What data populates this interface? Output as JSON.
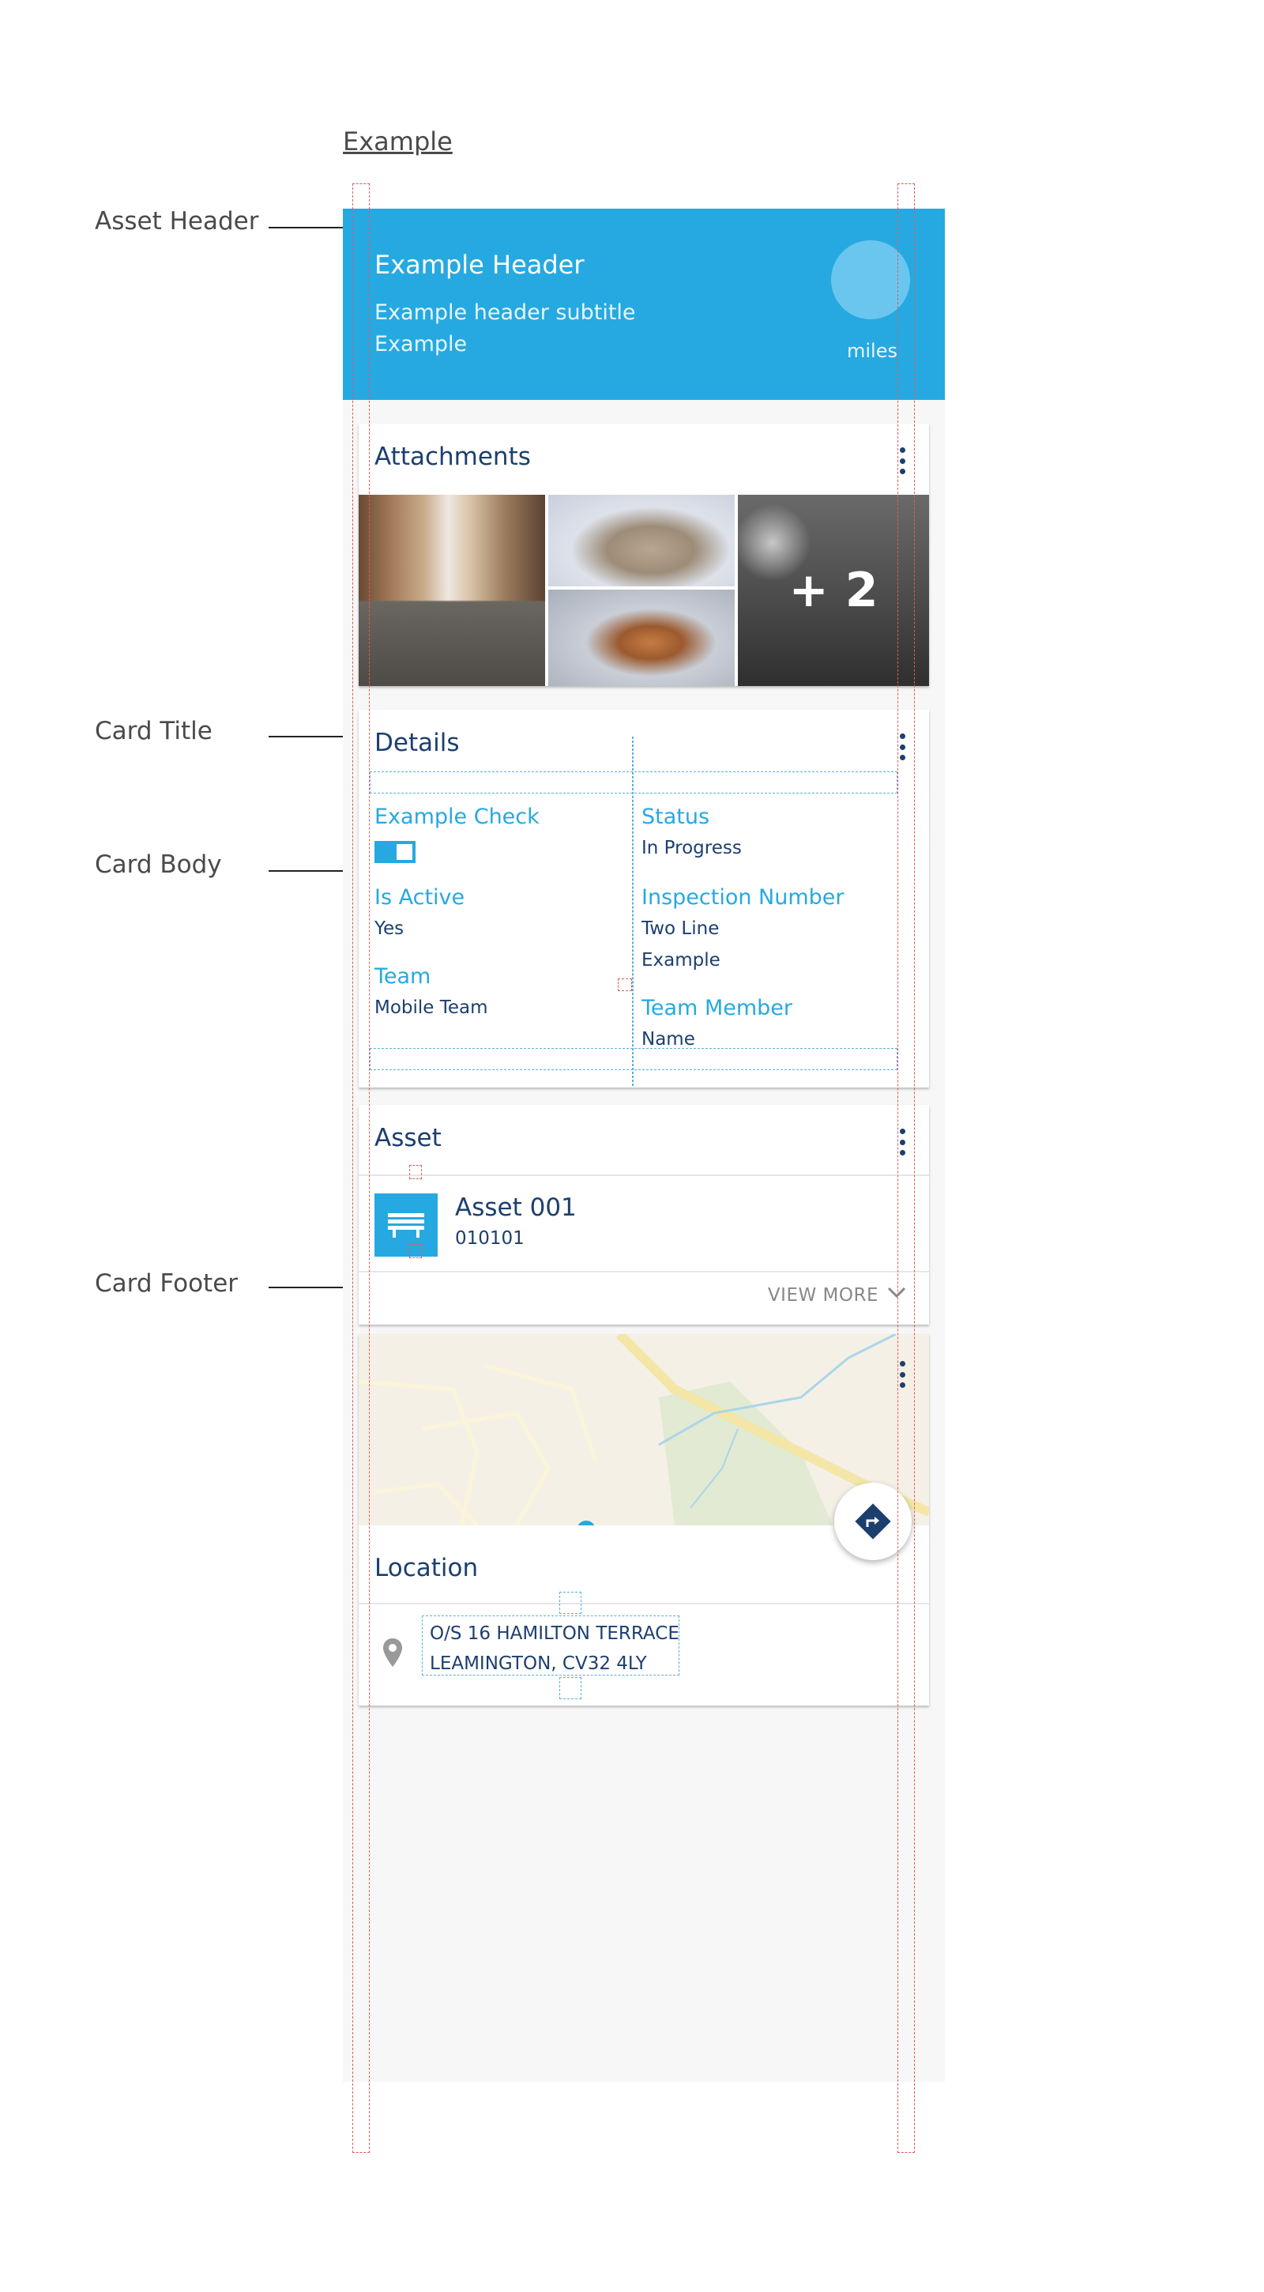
{
  "doc": {
    "example_title": "Example",
    "annotations": {
      "asset_header": "Asset Header",
      "card_title": "Card Title",
      "card_body": "Card Body",
      "card_footer": "Card Footer"
    }
  },
  "header": {
    "title": "Example Header",
    "subtitle_line1": "Example header subtitle",
    "subtitle_line2": "Example",
    "miles_label": "miles"
  },
  "attachments": {
    "title": "Attachments",
    "more_count": "+ 2"
  },
  "details": {
    "title": "Details",
    "fields": {
      "example_check": {
        "label": "Example Check",
        "value": true
      },
      "status": {
        "label": "Status",
        "value": "In Progress"
      },
      "is_active": {
        "label": "Is Active",
        "value": "Yes"
      },
      "inspection_number": {
        "label": "Inspection Number",
        "value_line1": "Two Line",
        "value_line2": "Example"
      },
      "team": {
        "label": "Team",
        "value": "Mobile Team"
      },
      "team_member": {
        "label": "Team Member",
        "value": "Name"
      }
    }
  },
  "asset": {
    "title": "Asset",
    "name": "Asset 001",
    "id": "010101",
    "view_more": "VIEW MORE"
  },
  "location": {
    "title": "Location",
    "address_line1": "O/S 16 HAMILTON TERRACE",
    "address_line2": "LEAMINGTON, CV32 4LY"
  },
  "colors": {
    "primary": "#26a9e1",
    "text_dark": "#1c3f6e",
    "background": "#f7f7f7"
  },
  "icons": [
    "kebab-icon",
    "bench-icon",
    "chevron-down-icon",
    "location-pin-icon",
    "directions-icon"
  ]
}
